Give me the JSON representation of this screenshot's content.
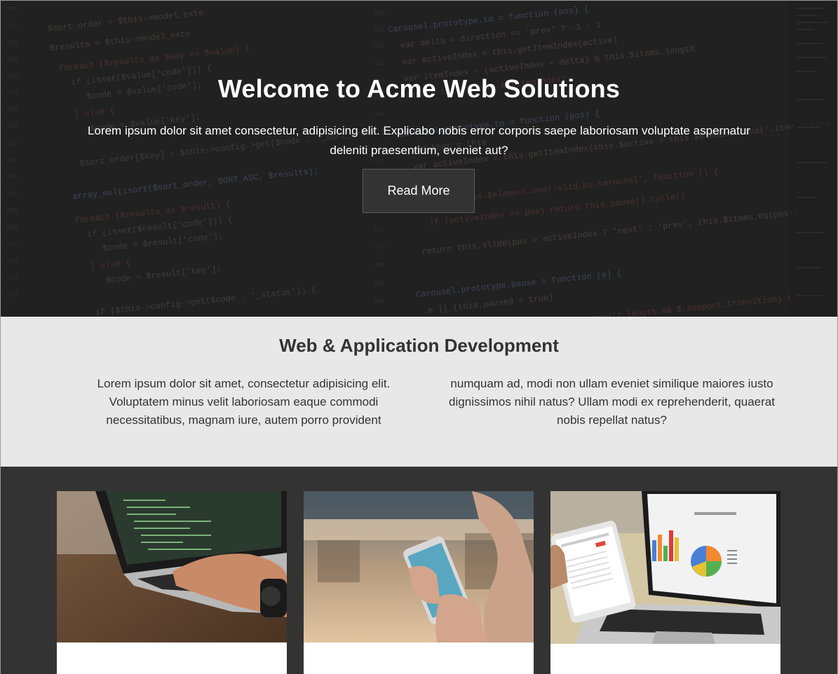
{
  "hero": {
    "title": "Welcome to Acme Web Solutions",
    "text": "Lorem ipsum dolor sit amet consectetur, adipisicing elit. Explicabo nobis error corporis saepe laboriosam voluptate aspernatur deleniti praesentium, eveniet aut?",
    "button_label": "Read More",
    "background": "code-editor-photo"
  },
  "services": {
    "title": "Web & Application Development",
    "text": "Lorem ipsum dolor sit amet, consectetur adipisicing elit. Voluptatem minus velit laboriosam eaque commodi necessitatibus, magnam iure, autem porro provident numquam ad, modi non ullam eveniet similique maiores iusto dignissimos nihil natus? Ullam modi ex reprehenderit, quaerat nobis repellat natus?"
  },
  "gallery": {
    "cards": [
      {
        "image": "laptop-typing-photo"
      },
      {
        "image": "smartphone-in-hand-photo"
      },
      {
        "image": "laptop-and-tablet-charts-photo"
      }
    ]
  },
  "colors": {
    "hero_overlay": "#2b2b2b",
    "services_bg": "#e8e8e8",
    "gallery_bg": "#333333",
    "text_dark": "#333333"
  }
}
